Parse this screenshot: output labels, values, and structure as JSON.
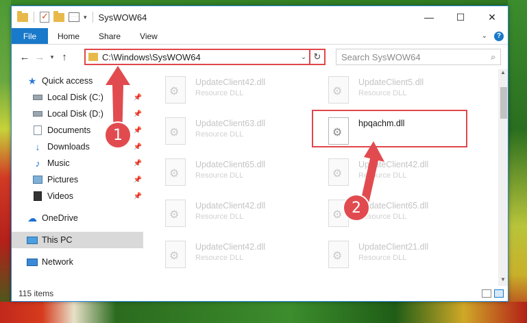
{
  "window": {
    "title": "SysWOW64",
    "controls": {
      "minimize": "—",
      "maximize": "☐",
      "close": "✕"
    }
  },
  "ribbon": {
    "tabs": [
      "File",
      "Home",
      "Share",
      "View"
    ]
  },
  "nav": {
    "address": "C:\\Windows\\SysWOW64",
    "search_placeholder": "Search SysWOW64"
  },
  "sidebar": {
    "items": [
      {
        "label": "Quick access",
        "icon": "star-icon",
        "pinned": false
      },
      {
        "label": "Local Disk (C:)",
        "icon": "drive-icon",
        "pinned": true
      },
      {
        "label": "Local Disk (D:)",
        "icon": "drive-icon",
        "pinned": true
      },
      {
        "label": "Documents",
        "icon": "documents-icon",
        "pinned": true
      },
      {
        "label": "Downloads",
        "icon": "downloads-icon",
        "pinned": true
      },
      {
        "label": "Music",
        "icon": "music-icon",
        "pinned": true
      },
      {
        "label": "Pictures",
        "icon": "pictures-icon",
        "pinned": true
      },
      {
        "label": "Videos",
        "icon": "videos-icon",
        "pinned": true
      },
      {
        "label": "OneDrive",
        "icon": "onedrive-icon",
        "pinned": false
      },
      {
        "label": "This PC",
        "icon": "pc-icon",
        "pinned": false,
        "selected": true
      },
      {
        "label": "Network",
        "icon": "network-icon",
        "pinned": false
      }
    ]
  },
  "files": [
    {
      "name": "UpdateClient42.dll",
      "desc": "Resource DLL"
    },
    {
      "name": "UpdateClient5.dll",
      "desc": "Resource DLL"
    },
    {
      "name": "UpdateClient63.dll",
      "desc": "Resource DLL"
    },
    {
      "name": "hpqachm.dll",
      "desc": "",
      "highlighted": true
    },
    {
      "name": "UpdateClient65.dll",
      "desc": "Resource DLL"
    },
    {
      "name": "UpdateClient42.dll",
      "desc": "Resource DLL"
    },
    {
      "name": "UpdateClient42.dll",
      "desc": "Resource DLL"
    },
    {
      "name": "UpdateClient65.dll",
      "desc": "Resource DLL"
    },
    {
      "name": "UpdateClient42.dll",
      "desc": "Resource DLL"
    },
    {
      "name": "UpdateClient21.dll",
      "desc": "Resource DLL"
    }
  ],
  "status": {
    "item_count": "115 items"
  },
  "annotations": {
    "step1": "1",
    "step2": "2"
  },
  "colors": {
    "accent": "#1979ca",
    "highlight": "#e0464a"
  }
}
